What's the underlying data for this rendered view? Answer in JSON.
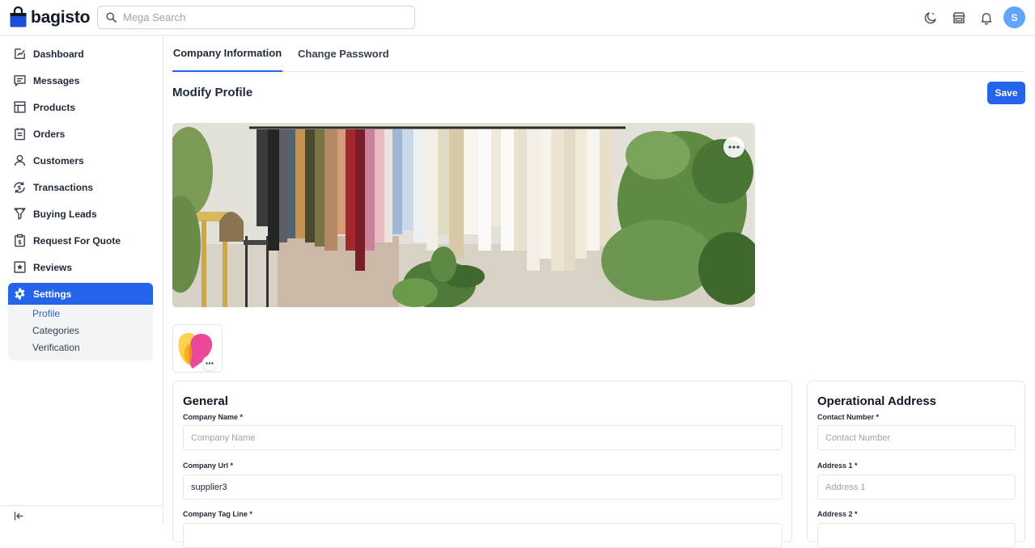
{
  "header": {
    "logo_text": "bagisto",
    "search_placeholder": "Mega Search",
    "avatar_initial": "S",
    "icons": [
      "dark-mode-icon",
      "storefront-icon",
      "notification-bell-icon"
    ]
  },
  "sidebar": {
    "items": [
      {
        "label": "Dashboard",
        "icon": "dashboard-icon"
      },
      {
        "label": "Messages",
        "icon": "messages-icon"
      },
      {
        "label": "Products",
        "icon": "products-icon"
      },
      {
        "label": "Orders",
        "icon": "orders-icon"
      },
      {
        "label": "Customers",
        "icon": "customers-icon"
      },
      {
        "label": "Transactions",
        "icon": "transactions-icon"
      },
      {
        "label": "Buying Leads",
        "icon": "buying-leads-icon"
      },
      {
        "label": "Request For Quote",
        "icon": "request-quote-icon"
      },
      {
        "label": "Reviews",
        "icon": "reviews-icon"
      },
      {
        "label": "Settings",
        "icon": "settings-gear-icon",
        "active": true
      }
    ],
    "settings_sub": [
      {
        "label": "Profile",
        "active": true
      },
      {
        "label": "Categories"
      },
      {
        "label": "Verification"
      }
    ]
  },
  "tabs": [
    {
      "label": "Company Information",
      "active": true
    },
    {
      "label": "Change Password"
    }
  ],
  "page": {
    "title": "Modify Profile",
    "save_label": "Save"
  },
  "general": {
    "title": "General",
    "company_name": {
      "label": "Company Name *",
      "placeholder": "Company Name",
      "value": ""
    },
    "company_url": {
      "label": "Company Url *",
      "value": "supplier3"
    },
    "company_tag_line": {
      "label": "Company Tag Line *"
    }
  },
  "operational": {
    "title": "Operational Address",
    "contact_number": {
      "label": "Contact Number *",
      "placeholder": "Contact Number"
    },
    "address1": {
      "label": "Address 1 *",
      "placeholder": "Address 1"
    },
    "address2": {
      "label": "Address 2 *"
    }
  },
  "colors": {
    "accent": "#2563eb",
    "avatar": "#60a5fa"
  }
}
